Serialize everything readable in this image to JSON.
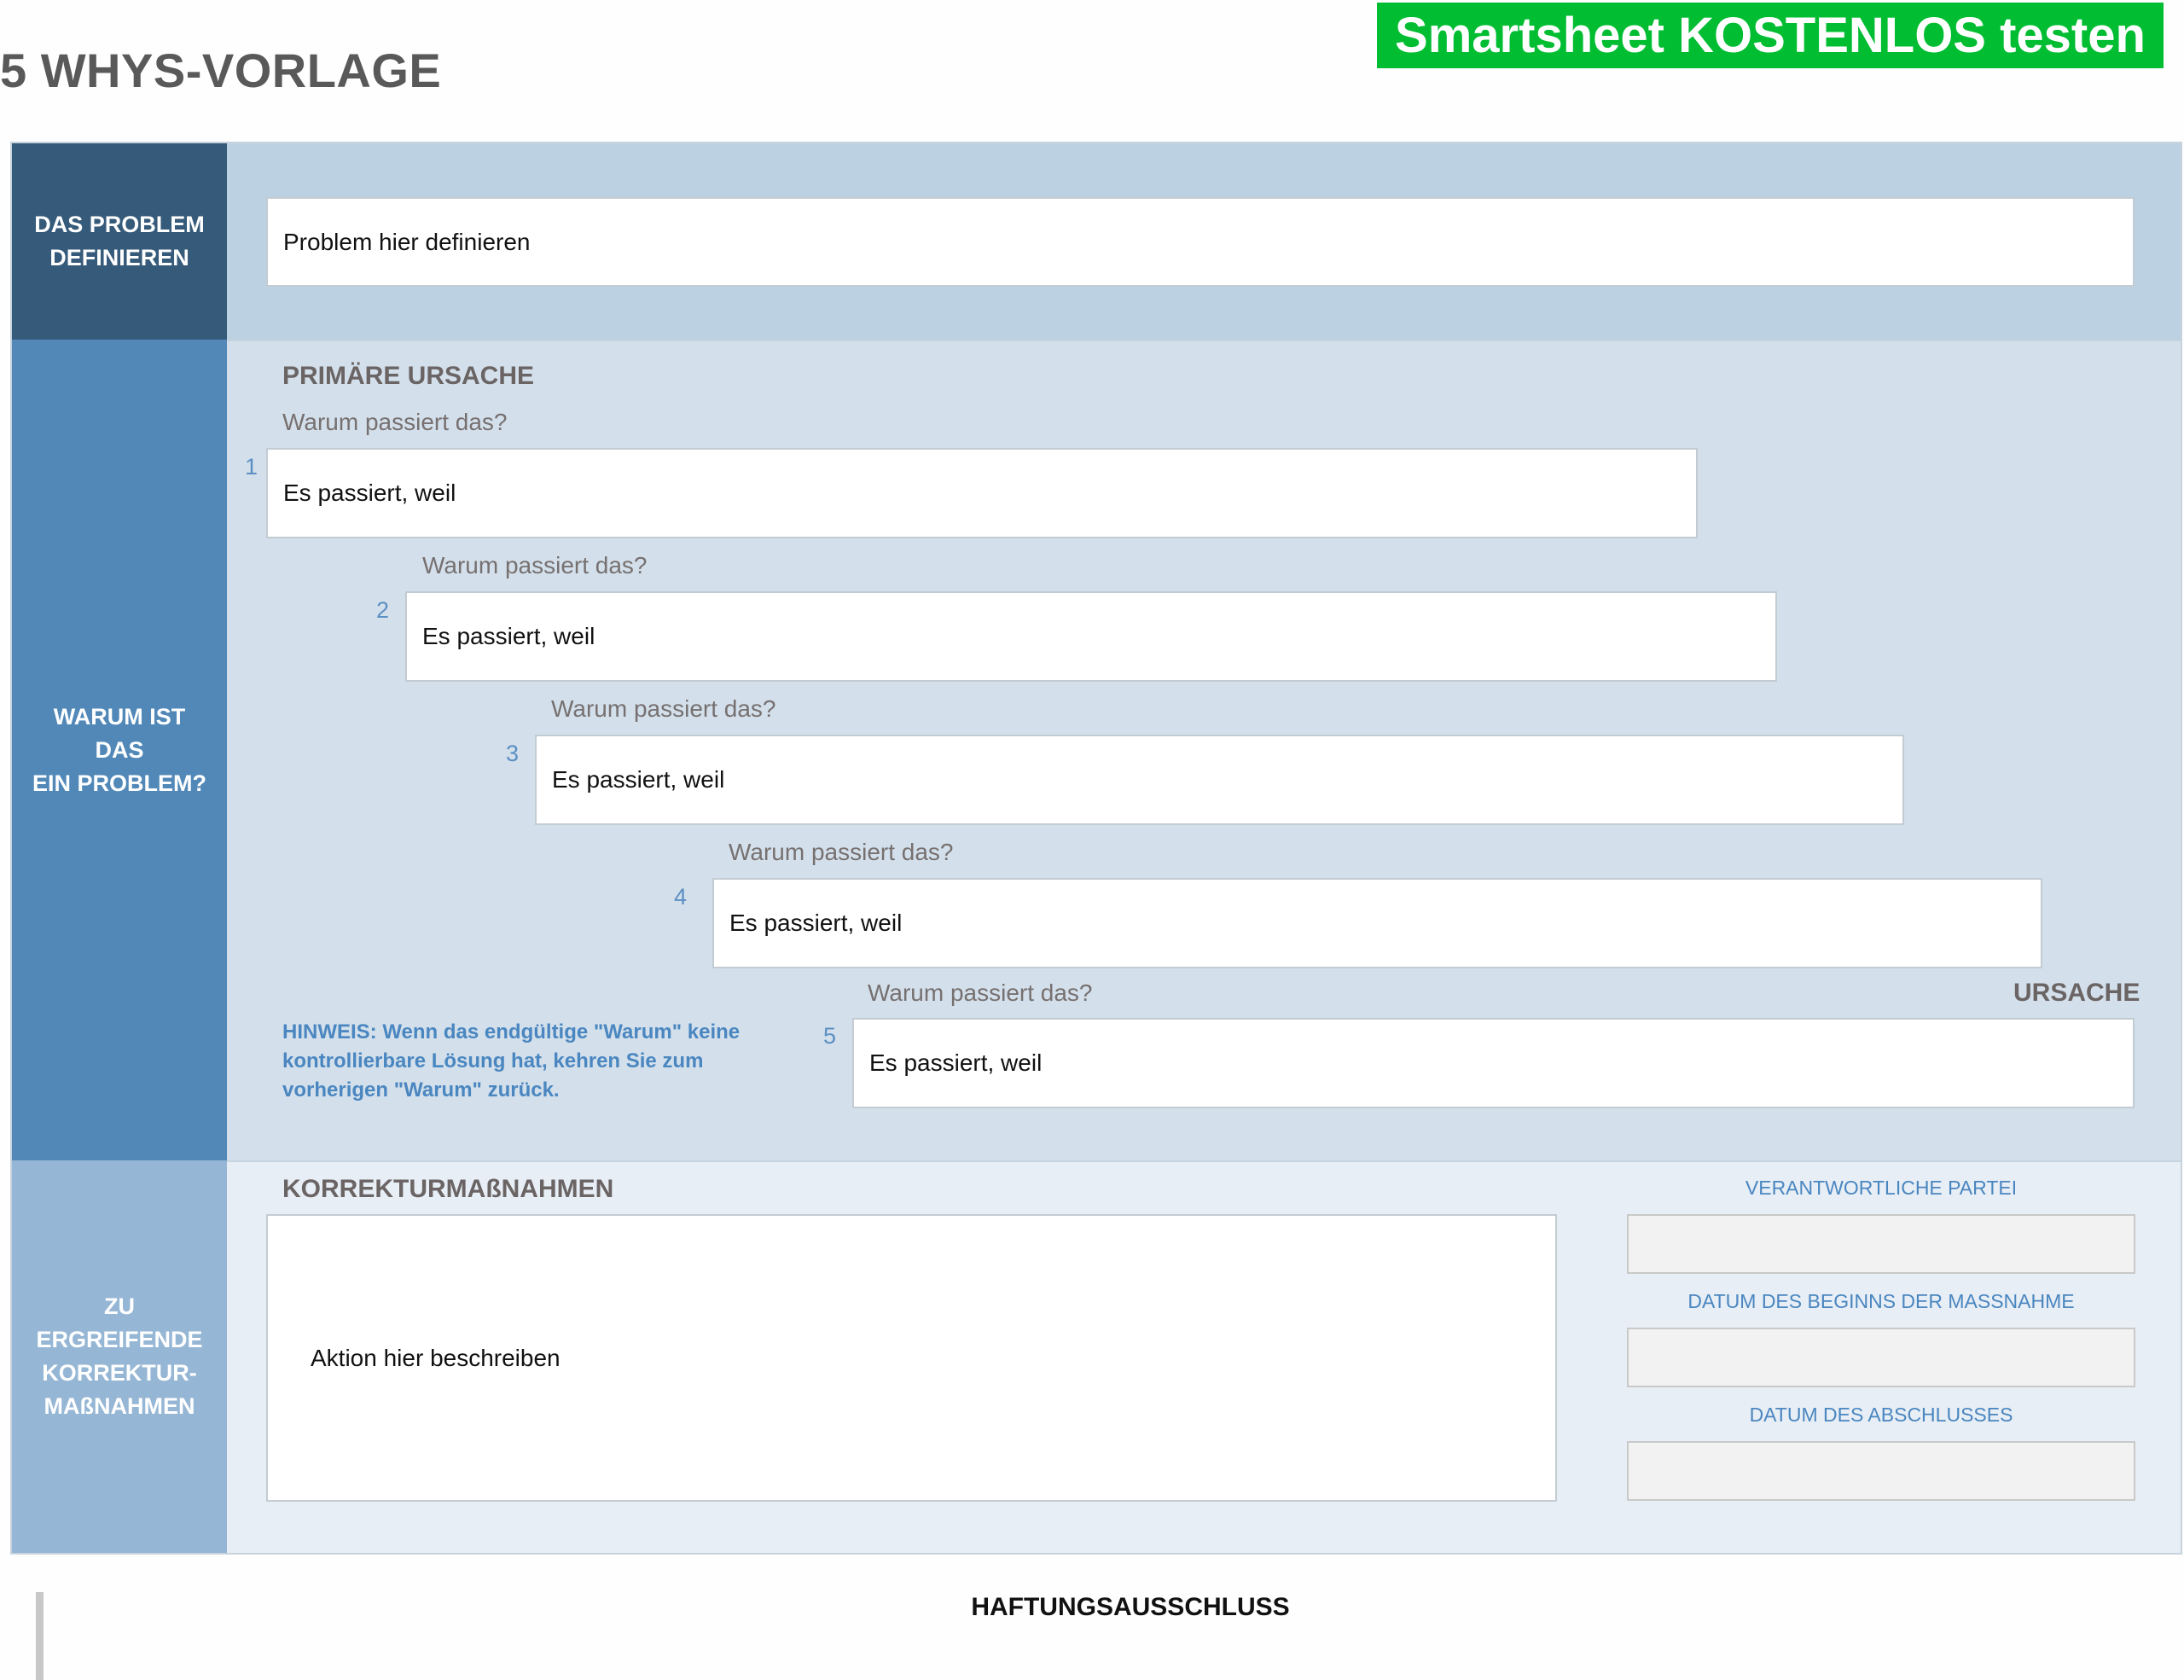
{
  "title": "5 WHYS-VORLAGE",
  "cta_label": "Smartsheet KOSTENLOS testen",
  "sections": {
    "problem_label": "DAS PROBLEM\nDEFINIEREN",
    "why_label": "WARUM IST\nDAS\nEIN PROBLEM?",
    "action_label": "ZU\nERGREIFENDE\nKORREKTUR-\nMAßNAHMEN"
  },
  "problem": {
    "value": "Problem hier definieren"
  },
  "whys": {
    "primary_heading": "PRIMÄRE URSACHE",
    "cause_heading": "URSACHE",
    "items": [
      {
        "number": "1",
        "question": "Warum passiert das?",
        "answer": "Es passiert, weil"
      },
      {
        "number": "2",
        "question": "Warum passiert das?",
        "answer": "Es passiert, weil"
      },
      {
        "number": "3",
        "question": "Warum passiert das?",
        "answer": "Es passiert, weil"
      },
      {
        "number": "4",
        "question": "Warum passiert das?",
        "answer": "Es passiert, weil"
      },
      {
        "number": "5",
        "question": "Warum passiert das?",
        "answer": "Es passiert, weil"
      }
    ],
    "note": "HINWEIS: Wenn das endgültige \"Warum\" keine kontrollierbare Lösung hat, kehren Sie zum vorherigen \"Warum\" zurück."
  },
  "actions": {
    "heading": "KORREKTURMAßNAHMEN",
    "value": "Aktion hier beschreiben",
    "responsible_label": "VERANTWORTLICHE PARTEI",
    "responsible_value": "",
    "start_label": "DATUM DES BEGINNS DER MASSNAHME",
    "start_value": "",
    "end_label": "DATUM DES ABSCHLUSSES",
    "end_value": ""
  },
  "disclaimer": "HAFTUNGSAUSSCHLUSS",
  "colors": {
    "cta_green": "#00bd32",
    "section_dark": "#355a7a",
    "section_mid": "#5188b8",
    "section_light": "#95b6d4",
    "accent_blue": "#4a86c0"
  }
}
